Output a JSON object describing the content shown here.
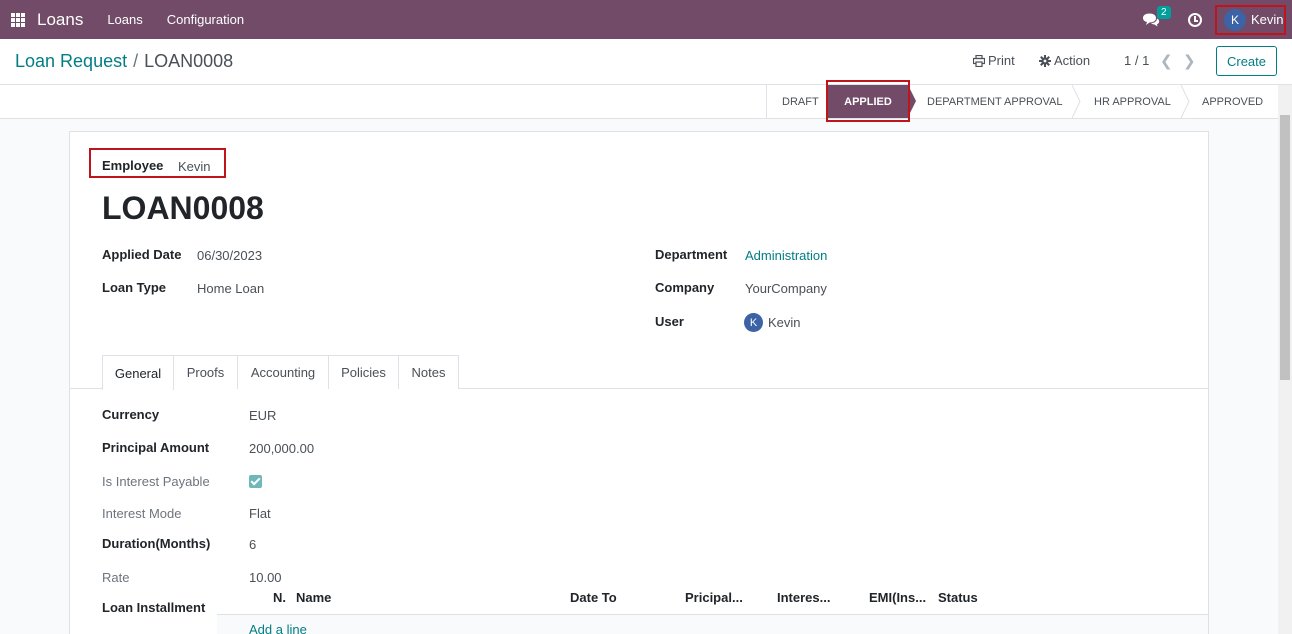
{
  "navbar": {
    "app_title": "Loans",
    "menu": [
      "Loans",
      "Configuration"
    ],
    "chat_badge": "2",
    "user_initial": "K",
    "user_name": "Kevin"
  },
  "control": {
    "breadcrumb_parent": "Loan Request",
    "breadcrumb_sep": "/",
    "breadcrumb_current": "LOAN0008",
    "print_label": "Print",
    "action_label": "Action",
    "pager": "1 / 1",
    "create_label": "Create"
  },
  "statusbar": {
    "stages": [
      "DRAFT",
      "APPLIED",
      "DEPARTMENT APPROVAL",
      "HR APPROVAL",
      "APPROVED"
    ],
    "active": "APPLIED"
  },
  "form": {
    "employee_label": "Employee",
    "employee_value": "Kevin",
    "name": "LOAN0008",
    "applied_date_label": "Applied Date",
    "applied_date_value": "06/30/2023",
    "loan_type_label": "Loan Type",
    "loan_type_value": "Home Loan",
    "department_label": "Department",
    "department_value": "Administration",
    "company_label": "Company",
    "company_value": "YourCompany",
    "user_label": "User",
    "user_initial": "K",
    "user_value": "Kevin"
  },
  "tabs": [
    "General",
    "Proofs",
    "Accounting",
    "Policies",
    "Notes"
  ],
  "general": {
    "currency_label": "Currency",
    "currency_value": "EUR",
    "principal_label": "Principal Amount",
    "principal_value": "200,000.00",
    "interest_payable_label": "Is Interest Payable",
    "interest_payable_checked": true,
    "interest_mode_label": "Interest Mode",
    "interest_mode_value": "Flat",
    "duration_label": "Duration(Months)",
    "duration_value": "6",
    "rate_label": "Rate",
    "rate_value": "10.00",
    "installment_label": "Loan Installment"
  },
  "installment_table": {
    "columns": [
      "N.",
      "Name",
      "Date To",
      "Pricipal...",
      "Interes...",
      "EMI(Ins...",
      "Status"
    ],
    "add_line": "Add a line"
  },
  "colors": {
    "brand": "#714b67",
    "accent": "#017e84",
    "highlight": "#c0141c"
  }
}
